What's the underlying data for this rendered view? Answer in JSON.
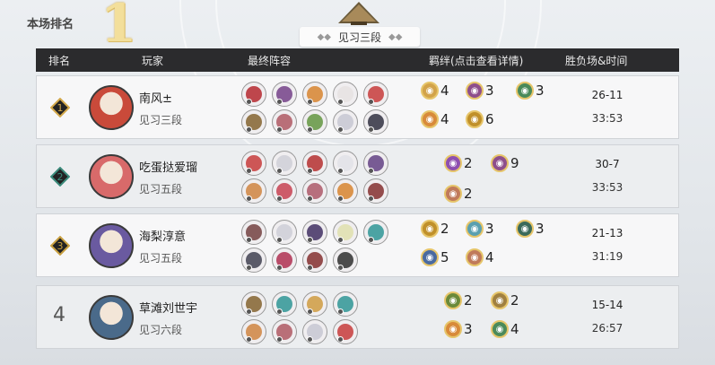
{
  "page": {
    "title_label": "本场排名",
    "rank": "1",
    "division": "见习三段"
  },
  "columns": {
    "rank": "排名",
    "player": "玩家",
    "lineup": "最终阵容",
    "bonds": "羁绊(点击查看详情)",
    "record": "胜负场&时间"
  },
  "rows": [
    {
      "rank": "1",
      "name": "南风±",
      "division": "见习三段",
      "score": "26-11",
      "time": "33:53",
      "avatar_color": "#c94a3a",
      "heroes": [
        [
          "#b8333a",
          "#7b4a8e",
          "#d88a3a",
          "#e7e2e2",
          "#c94545"
        ],
        [
          "#8a6a3a",
          "#b3606a",
          "#6a9a4a",
          "#c9c9d4",
          "#3b3b4a"
        ]
      ],
      "bonds": [
        [
          "#d2a34a",
          "4"
        ],
        [
          "#8e4f8c",
          "3"
        ],
        [
          "#4a8a5a",
          "3"
        ],
        [
          "#d88a3a",
          "4"
        ],
        [
          "#c0902a",
          "6"
        ]
      ]
    },
    {
      "rank": "2",
      "name": "吃蛋挞爱瑠",
      "division": "见习五段",
      "score": "30-7",
      "time": "33:53",
      "avatar_color": "#d86a6a",
      "heroes": [
        [
          "#c94545",
          "#d0d0d8",
          "#b83a3a",
          "#e2e2e8",
          "#6a4a8a"
        ],
        [
          "#d08a4a",
          "#c94a5a",
          "#b06070",
          "#d88a3a",
          "#8a3a3a"
        ]
      ],
      "bonds": [
        [
          "#8e4fb0",
          "2"
        ],
        [
          "#8e4f8c",
          "9"
        ],
        [
          "#c07a5a",
          "2"
        ]
      ]
    },
    {
      "rank": "3",
      "name": "海梨淳意",
      "division": "见习五段",
      "score": "21-13",
      "time": "31:19",
      "avatar_color": "#6a5aa0",
      "heroes": [
        [
          "#7a4a4a",
          "#cfcfd8",
          "#4a3a6a",
          "#e0e0b0",
          "#3a9a9a"
        ],
        [
          "#4a4a5a",
          "#b33a5a",
          "#8a3a3a",
          "#3a3a3a"
        ]
      ],
      "bonds": [
        [
          "#c0902a",
          "2"
        ],
        [
          "#5aa0b0",
          "3"
        ],
        [
          "#3a6a5a",
          "3"
        ],
        [
          "#4a6aa0",
          "5"
        ],
        [
          "#c07a5a",
          "4"
        ]
      ]
    },
    {
      "rank": "4",
      "name": "草滩刘世宇",
      "division": "见习六段",
      "score": "15-14",
      "time": "26:57",
      "avatar_color": "#4a6a8a",
      "heroes": [
        [
          "#8a6a3a",
          "#3a9a9a",
          "#d0a04a",
          "#3a9a9a"
        ],
        [
          "#d08a4a",
          "#b3606a",
          "#c9c9d4",
          "#c94545"
        ]
      ],
      "bonds": [
        [
          "#6a8a3a",
          "2"
        ],
        [
          "#a08040",
          "2"
        ],
        [
          "#d88a3a",
          "3"
        ],
        [
          "#4a8a5a",
          "4"
        ]
      ]
    }
  ]
}
